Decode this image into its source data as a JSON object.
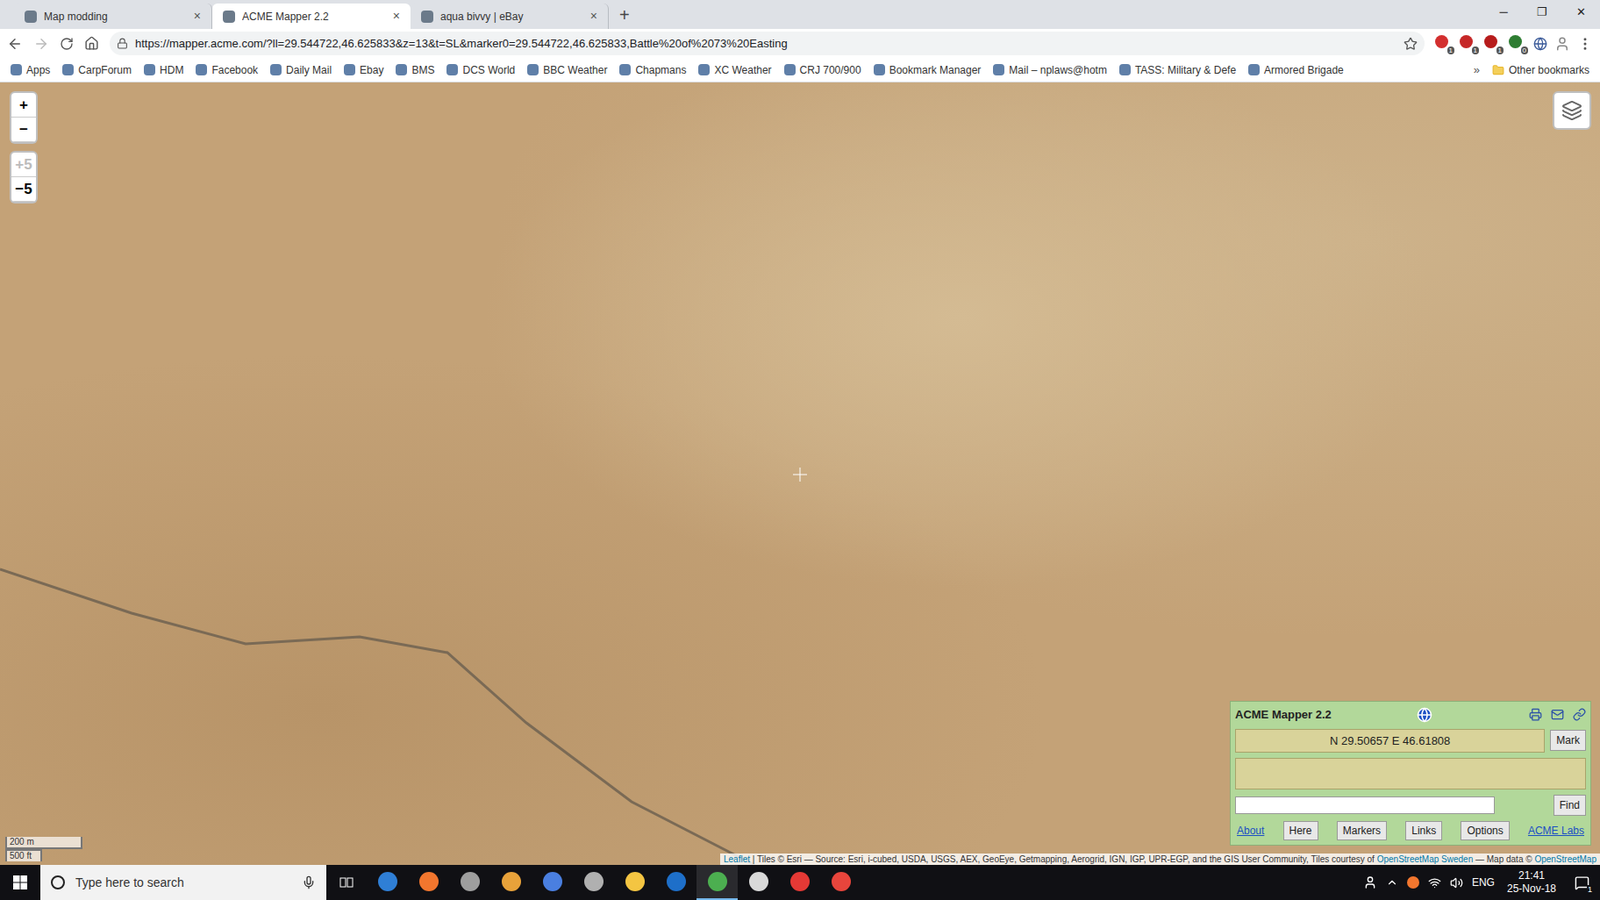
{
  "window": {
    "controls": [
      "─",
      "❐",
      "✕"
    ]
  },
  "tabs": [
    {
      "label": "Map modding",
      "selected": false,
      "close": "×"
    },
    {
      "label": "ACME Mapper 2.2",
      "selected": true,
      "close": "×"
    },
    {
      "label": "aqua bivvy | eBay",
      "selected": false,
      "close": "×"
    }
  ],
  "new_tab": "+",
  "address_bar": {
    "url": "https://mapper.acme.com/?ll=29.544722,46.625833&z=13&t=SL&marker0=29.544722,46.625833,Battle%20of%2073%20Easting",
    "secure": true,
    "starred": false
  },
  "extensions": [
    {
      "badge": "1",
      "color": "#d32f2f"
    },
    {
      "badge": "1",
      "color": "#c62828"
    },
    {
      "badge": "1",
      "color": "#b71c1c"
    },
    {
      "badge": "0",
      "color": "#2e7d32"
    }
  ],
  "bookmarks": [
    {
      "label": "Apps"
    },
    {
      "label": "CarpForum"
    },
    {
      "label": "HDM"
    },
    {
      "label": "Facebook"
    },
    {
      "label": "Daily Mail"
    },
    {
      "label": "Ebay"
    },
    {
      "label": "BMS"
    },
    {
      "label": "DCS World"
    },
    {
      "label": "BBC Weather"
    },
    {
      "label": "Chapmans"
    },
    {
      "label": "XC Weather"
    },
    {
      "label": "CRJ 700/900"
    },
    {
      "label": "Bookmark Manager"
    },
    {
      "label": "Mail – nplaws@hotm"
    },
    {
      "label": "TASS: Military & Defe"
    },
    {
      "label": "Armored Brigade"
    }
  ],
  "bookmarks_more": "»",
  "other_bookmarks": "Other bookmarks",
  "map": {
    "zoom_controls": [
      {
        "label": "+",
        "disabled": false
      },
      {
        "label": "−",
        "disabled": false
      },
      {
        "label": "+5",
        "disabled": true
      },
      {
        "label": "−5",
        "disabled": false
      }
    ],
    "scale": [
      "200 m",
      "500 ft"
    ],
    "attribution": [
      {
        "text": "Leaflet",
        "link": true
      },
      {
        "text": " | Tiles © Esri — Source: Esri, i-cubed, USDA, USGS, AEX, GeoEye, Getmapping, Aerogrid, IGN, IGP, UPR-EGP, and the GIS User Community, Tiles courtesy of ",
        "link": false
      },
      {
        "text": "OpenStreetMap Sweden",
        "link": true
      },
      {
        "text": " — Map data © ",
        "link": false
      },
      {
        "text": "OpenStreetMap",
        "link": true
      }
    ]
  },
  "panel": {
    "title": "ACME Mapper 2.2",
    "coordinates": "N 29.50657 E 46.61808",
    "mark": "Mark",
    "find": "Find",
    "search_value": "",
    "links": [
      {
        "label": "About",
        "kind": "link"
      },
      {
        "label": "Here",
        "kind": "button"
      },
      {
        "label": "Markers",
        "kind": "button"
      },
      {
        "label": "Links",
        "kind": "button"
      },
      {
        "label": "Options",
        "kind": "button"
      },
      {
        "label": "ACME Labs",
        "kind": "link"
      }
    ]
  },
  "taskbar": {
    "search_placeholder": "Type here to search",
    "apps": [
      {
        "color": "#2f7fd6",
        "active": false
      },
      {
        "color": "#f2762e",
        "active": false
      },
      {
        "color": "#9e9e9e",
        "active": false
      },
      {
        "color": "#e8a23a",
        "active": false
      },
      {
        "color": "#4a7fe0",
        "active": false
      },
      {
        "color": "#b0b0b0",
        "active": false
      },
      {
        "color": "#f4c542",
        "active": false
      },
      {
        "color": "#1e6fc9",
        "active": false
      },
      {
        "color": "#4caf50",
        "active": true
      },
      {
        "color": "#d9d9d9",
        "active": false
      },
      {
        "color": "#e53935",
        "active": false
      },
      {
        "color": "#e8453c",
        "active": false
      }
    ],
    "language": "ENG",
    "time": "21:41",
    "date": "25-Nov-18",
    "notifications": "1"
  }
}
